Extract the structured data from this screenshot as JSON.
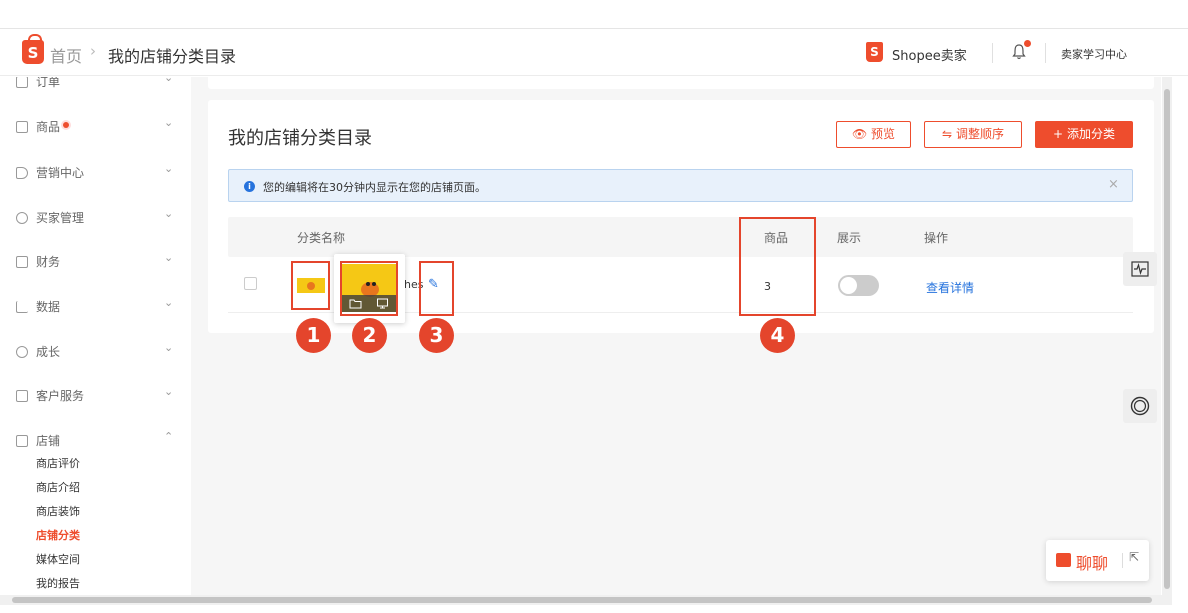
{
  "header": {
    "logo_letter": "S",
    "breadcrumb_home": "首页",
    "breadcrumb_sep": "›",
    "breadcrumb_current": "我的店铺分类目录",
    "seller_label": "Shopee卖家",
    "learning_center": "卖家学习中心"
  },
  "sidebar": {
    "items": [
      {
        "label": "订单",
        "chevron": "⌄"
      },
      {
        "label": "商品",
        "chevron": "⌄"
      },
      {
        "label": "营销中心",
        "chevron": "⌄"
      },
      {
        "label": "买家管理",
        "chevron": "⌄"
      },
      {
        "label": "财务",
        "chevron": "⌄"
      },
      {
        "label": "数据",
        "chevron": "⌄"
      },
      {
        "label": "成长",
        "chevron": "⌄"
      },
      {
        "label": "客户服务",
        "chevron": "⌄"
      },
      {
        "label": "店铺",
        "chevron": "⌃"
      }
    ],
    "sub_items": [
      "商店评价",
      "商店介绍",
      "商店装饰",
      "店铺分类",
      "媒体空间",
      "我的报告"
    ]
  },
  "main": {
    "title": "我的店铺分类目录",
    "preview_button": "预览",
    "preview_icon": "👁",
    "reorder_button": "调整顺序",
    "reorder_icon": "⇋",
    "add_button": "添加分类",
    "add_icon": "+",
    "notice_icon": "i",
    "notice_text": "您的编辑将在30分钟内显示在您的店铺页面。",
    "notice_close": "×"
  },
  "table": {
    "headers": {
      "name": "分类名称",
      "products": "商品",
      "display": "展示",
      "actions": "操作"
    },
    "rows": [
      {
        "name": "hes",
        "edit_icon": "✎",
        "count": "3",
        "display_on": false,
        "action": "查看详情"
      }
    ]
  },
  "annotations": [
    "1",
    "2",
    "3",
    "4"
  ],
  "chat": {
    "label": "聊聊",
    "minimize": "⇱"
  },
  "tools": {
    "monitor_icon": "⌇",
    "support_icon": "◯"
  },
  "colors": {
    "brand": "#ee4d2d",
    "link": "#2673dd",
    "annotation": "#e4452c"
  }
}
